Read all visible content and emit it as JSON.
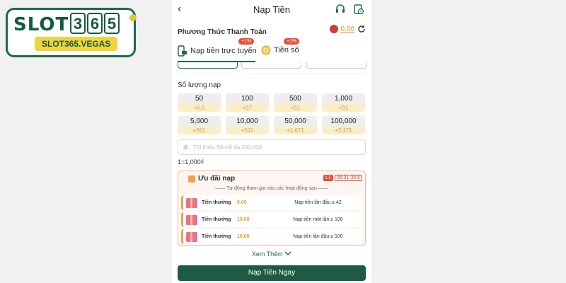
{
  "logo": {
    "word": "SLOT",
    "digits": [
      "3",
      "6",
      "5"
    ],
    "domain": "SLOT365.VEGAS"
  },
  "header": {
    "title": "Nạp Tiền",
    "back": "‹"
  },
  "method": {
    "label": "Phương Thức Thanh Toán",
    "balance": "0.00"
  },
  "tabs": [
    {
      "label": "Nạp tiền trực tuyến",
      "badge": "+1%"
    },
    {
      "label": "Tiền số",
      "badge": "+1%"
    }
  ],
  "amounts": {
    "label": "Số lượng nạp",
    "items": [
      {
        "amount": "50",
        "bonus": "+6.5"
      },
      {
        "amount": "100",
        "bonus": "+27"
      },
      {
        "amount": "500",
        "bonus": "+51"
      },
      {
        "amount": "1,000",
        "bonus": "+91"
      },
      {
        "amount": "5,000",
        "bonus": "+261"
      },
      {
        "amount": "10,000",
        "bonus": "+511"
      },
      {
        "amount": "50,000",
        "bonus": "+1,671"
      },
      {
        "amount": "100,000",
        "bonus": "+3,171"
      }
    ]
  },
  "input": {
    "placeholder": "Tối thiểu 50–tối đa 300,000"
  },
  "rate": "1=1,000₫",
  "promo": {
    "title": "Ưu đãi nạp",
    "timer_badge": "L1",
    "timer": "06:31:35:5",
    "subtitle": "—— Tự động tham gia vào các hoạt động sau ——",
    "rows": [
      {
        "label": "Tiền thưởng",
        "value": "6.00",
        "cond": "Nạp tiền lần đầu ≥ 42"
      },
      {
        "label": "Tiền thưởng",
        "value": "10.00",
        "cond": "Nạp tiền một lần ≥ 100"
      },
      {
        "label": "Tiền thưởng",
        "value": "16.00",
        "cond": "Nạp tiền lần đầu ≥ 100"
      }
    ]
  },
  "more": "Xem Thêm",
  "cta": "Nạp Tiền Ngay"
}
